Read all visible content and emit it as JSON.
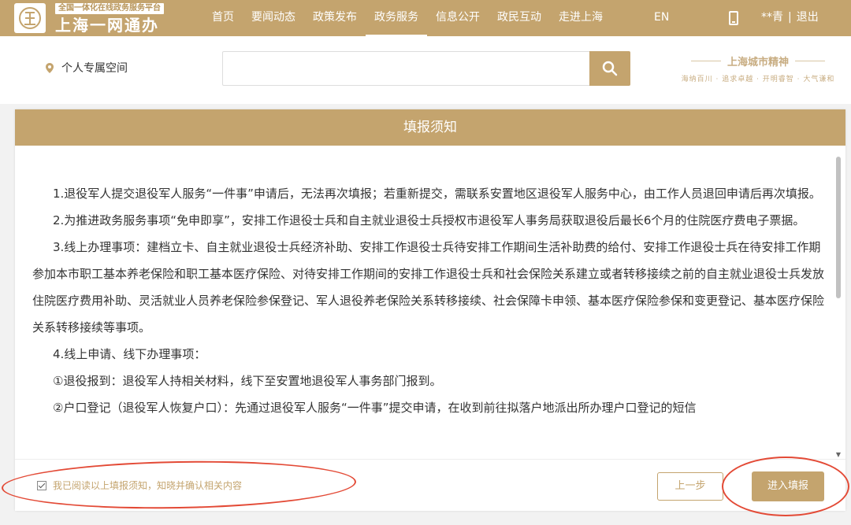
{
  "header": {
    "tagline": "全国一体化在线政务服务平台",
    "brand": "上海一网通办",
    "nav": [
      "首页",
      "要闻动态",
      "政策发布",
      "政务服务",
      "信息公开",
      "政民互动",
      "走进上海"
    ],
    "active_nav": "政务服务",
    "lang": "EN",
    "user": "**青",
    "separator": "|",
    "logout": "退出"
  },
  "subbar": {
    "personal_space": "个人专属空间",
    "search_placeholder": "",
    "spirit_title": "上海城市精神",
    "spirit_sub": "海纳百川 · 追求卓越 · 开明睿智 · 大气谦和"
  },
  "panel": {
    "title": "填报须知",
    "paragraphs": [
      "1.退役军人提交退役军人服务“一件事”申请后，无法再次填报；若重新提交，需联系安置地区退役军人服务中心，由工作人员退回申请后再次填报。",
      "2.为推进政务服务事项“免申即享”，安排工作退役士兵和自主就业退役士兵授权市退役军人事务局获取退役后最长6个月的住院医疗费电子票据。",
      "3.线上办理事项：建档立卡、自主就业退役士兵经济补助、安排工作退役士兵待安排工作期间生活补助费的给付、安排工作退役士兵在待安排工作期参加本市职工基本养老保险和职工基本医疗保险、对待安排工作期间的安排工作退役士兵和社会保险关系建立或者转移接续之前的自主就业退役士兵发放住院医疗费用补助、灵活就业人员养老保险参保登记、军人退役养老保险关系转移接续、社会保障卡申领、基本医疗保险参保和变更登记、基本医疗保险关系转移接续等事项。",
      "4.线上申请、线下办理事项：",
      "①退役报到：退役军人持相关材料，线下至安置地退役军人事务部门报到。",
      "②户口登记（退役军人恢复户口）：先通过退役军人服务“一件事”提交申请，在收到前往拟落户地派出所办理户口登记的短信"
    ],
    "agree_text": "我已阅读以上填报须知，知晓并确认相关内容",
    "agree_checked": true,
    "prev_label": "上一步",
    "next_label": "进入填报"
  },
  "colors": {
    "brand_gold": "#c4a46e",
    "annotation_red": "#e34a36"
  }
}
